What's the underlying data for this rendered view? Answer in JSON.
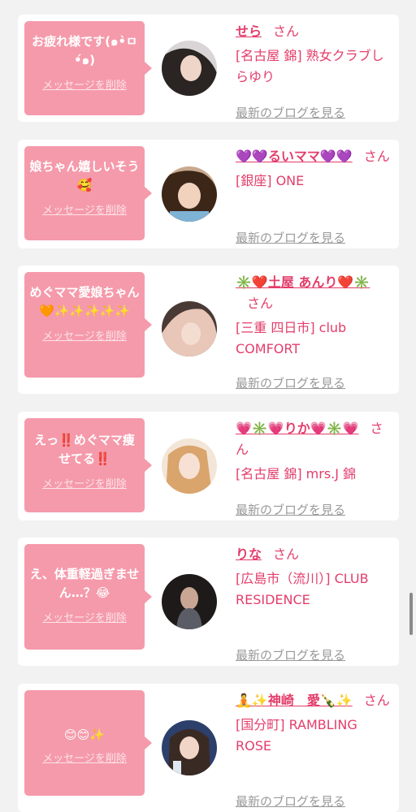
{
  "colors": {
    "bubble": "#f59aab",
    "accent": "#e33d6a",
    "link_gray": "#999999",
    "background": "#f2f2f2"
  },
  "labels": {
    "delete": "メッセージを削除",
    "blog": "最新のブログを見る",
    "san": "さん"
  },
  "cards": [
    {
      "message": "お疲れ様です(๑•̀ㅁ•́๑)",
      "name": "せら",
      "shop": "[名古屋 錦] 熟女クラブしらゆり"
    },
    {
      "message": "娘ちゃん嬉しいそう🥰",
      "name": "💜💜るいママ💜💜",
      "shop": "[銀座] ONE"
    },
    {
      "message": "めぐママ愛娘ちゃん🧡✨✨✨✨✨",
      "name": "✳️❤️土屋 あんり❤️✳️",
      "shop": "[三重 四日市] club COMFORT"
    },
    {
      "message": "えっ‼️めぐママ痩せてる‼️",
      "name": "💗✳️💗りか💗✳️💗",
      "shop": "[名古屋 錦] mrs.J 錦"
    },
    {
      "message": "え、体重軽過ぎません…？😂",
      "name": "りな",
      "shop": "[広島市（流川）] CLUB RESIDENCE"
    },
    {
      "message": "😊😊✨",
      "name": "🧘✨神崎　愛🍾✨",
      "shop": "[国分町] RAMBLING ROSE"
    }
  ]
}
